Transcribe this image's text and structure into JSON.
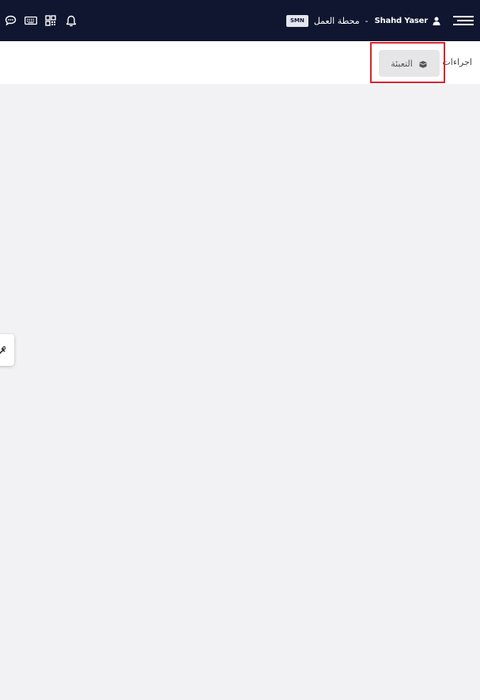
{
  "topbar": {
    "user_name": "Shahd Yaser",
    "separator": "-",
    "station_label": "محطة العمل",
    "station_badge": "SMN",
    "icons": [
      "chat-icon",
      "keyboard-icon",
      "qr-code-icon",
      "bell-icon",
      "user-icon",
      "menu-icon"
    ]
  },
  "actions": {
    "label": "اجراءات :",
    "fill_button": {
      "label": "التعبئة",
      "icon": "box-icon"
    }
  },
  "side_tab": {
    "icon": "tools-icon"
  },
  "colors": {
    "topbar_bg": "#101630",
    "page_bg": "#f2f2f4",
    "highlight": "#d9242f"
  }
}
